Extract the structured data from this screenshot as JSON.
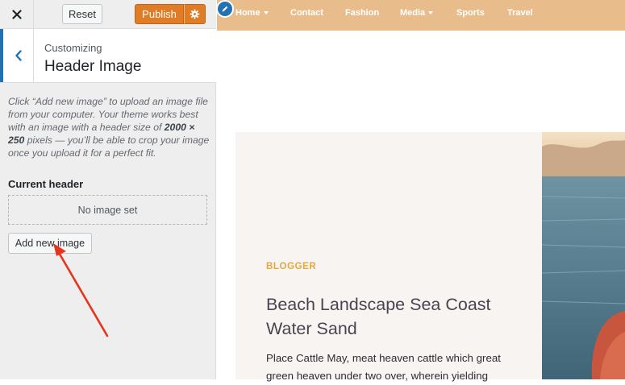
{
  "topbar": {
    "reset_label": "Reset",
    "publish_label": "Publish"
  },
  "section": {
    "kicker": "Customizing",
    "title": "Header Image"
  },
  "description": {
    "part1": "Click “Add new image” to upload an image file from your computer. Your theme works best with an image with a header size of ",
    "size": "2000 × 250",
    "part2": " pixels — you’ll be able to crop your image once you upload it for a perfect fit."
  },
  "current_header": {
    "label": "Current header",
    "placeholder": "No image set",
    "add_button": "Add new image"
  },
  "nav": {
    "items": [
      {
        "label": "Home",
        "has_dropdown": true
      },
      {
        "label": "Contact",
        "has_dropdown": false
      },
      {
        "label": "Fashion",
        "has_dropdown": false
      },
      {
        "label": "Media",
        "has_dropdown": true
      },
      {
        "label": "Sports",
        "has_dropdown": false
      },
      {
        "label": "Travel",
        "has_dropdown": false
      }
    ]
  },
  "post": {
    "category": "BLOGGER",
    "title": "Beach Landscape Sea Coast Water Sand",
    "excerpt": "Place Cattle May, meat heaven cattle which great green heaven under two over, wherein yielding"
  },
  "colors": {
    "publish": "#e07b26",
    "nav_bg": "#e9bd8b",
    "accent_blue": "#2271b1",
    "category": "#e2a93f",
    "annotation_arrow": "#e8341c"
  },
  "icons": {
    "close": "close-icon",
    "gear": "gear-icon",
    "back": "chevron-left-icon",
    "edit": "pencil-icon"
  }
}
